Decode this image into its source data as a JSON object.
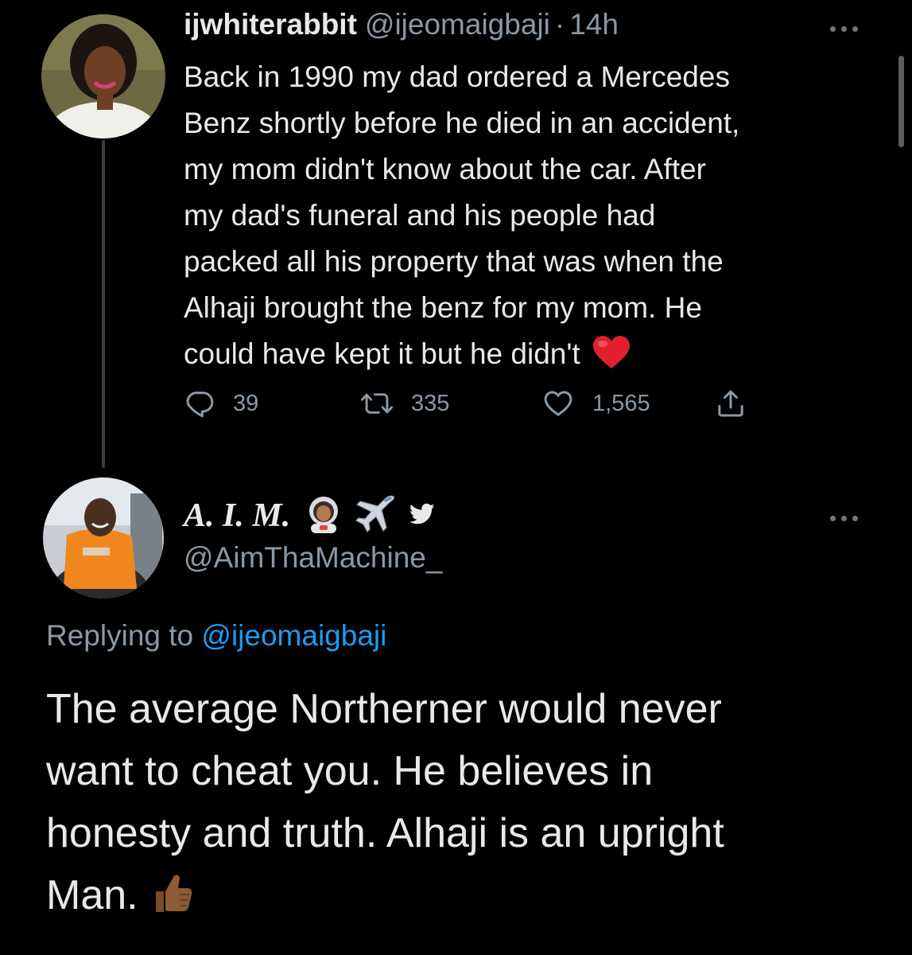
{
  "original_tweet": {
    "display_name": "ijwhiterabbit",
    "handle": "@ijeomaigbaji",
    "separator": "·",
    "time": "14h",
    "text_lines": [
      "Back in 1990 my dad ordered a Mercedes",
      "Benz shortly before he died in an accident,",
      "my mom didn't know about the car. After",
      "my dad's funeral and his people had",
      "packed all his property that was when the",
      "Alhaji brought the benz for my mom. He",
      "could have kept it but he didn't"
    ],
    "trailing_emoji": "red-heart",
    "stats": {
      "replies": "39",
      "retweets": "335",
      "likes": "1,565"
    },
    "icons": {
      "reply": "reply-icon",
      "retweet": "retweet-icon",
      "like": "heart-icon",
      "share": "share-icon",
      "more": "more-icon"
    }
  },
  "reply_tweet": {
    "display_name": "A. I. M.",
    "name_emojis": [
      "astronaut",
      "airplane",
      "bird-logo"
    ],
    "handle": "@AimThaMachine_",
    "replying_prefix": "Replying to",
    "replying_to": "@ijeomaigbaji",
    "text_lines": [
      "The average Northerner would never",
      "want to cheat you. He believes in",
      "honesty and truth. Alhaji is an upright",
      "Man."
    ],
    "trailing_emoji": "thumbs-up"
  },
  "colors": {
    "background": "#000000",
    "primary_text": "#e7e9ea",
    "secondary_text": "#8b98a5",
    "link": "#1d9bf0",
    "thread_line": "#3a3d41"
  }
}
